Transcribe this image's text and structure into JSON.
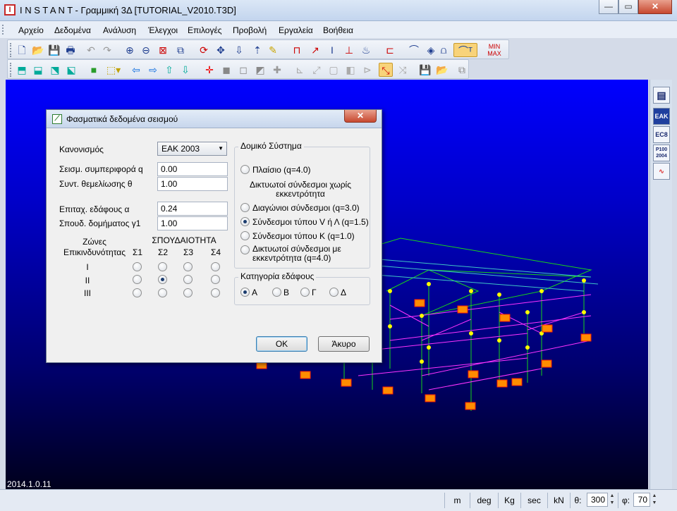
{
  "window": {
    "title": "I N S T A N T - Γραμμική 3Δ [TUTORIAL_V2010.T3D]",
    "controls": {
      "minimize": "—",
      "maximize": "▭",
      "close": "✕"
    }
  },
  "menu": [
    "Αρχείο",
    "Δεδομένα",
    "Ανάλυση",
    "Έλεγχοι",
    "Επιλογές",
    "Προβολή",
    "Εργαλεία",
    "Βοήθεια"
  ],
  "toolbar1": [
    "new-icon",
    "open-icon",
    "save-icon",
    "print-icon",
    "undo-icon",
    "redo-icon",
    "zoom-in-icon",
    "zoom-out-icon",
    "zoom-extents-icon",
    "zoom-window-icon",
    "rotate-icon",
    "pan-icon",
    "load-icon",
    "ruler-icon",
    "frame-icon",
    "member-icon",
    "support-icon",
    "section-icon",
    "beam-icon",
    "diagram-icon",
    "spectrum-icon",
    "minmax-icon"
  ],
  "toolbar2": [
    "view-iso-icon",
    "view-front-icon",
    "view-side-icon",
    "view-top-icon",
    "color-box-icon",
    "selection-icon",
    "left-arrow-icon",
    "right-arrow-icon",
    "up-arrow-icon",
    "down-arrow-icon",
    "node-icon"
  ],
  "version": "2014.1.0.11",
  "rightbar": [
    "window-icon",
    "ΕΑΚ",
    "EC8",
    "P100 2004",
    "spectrum-chart-icon"
  ],
  "statusbar": {
    "units": [
      "m",
      "deg",
      "Kg",
      "sec",
      "kN"
    ],
    "theta_label": "θ:",
    "theta_value": "300",
    "phi_label": "φ:",
    "phi_value": "70"
  },
  "dialog": {
    "title": "Φασματικά δεδομένα σεισμού",
    "code_label": "Κανονισμός",
    "code_value": "ΕΑΚ 2003",
    "q_label": "Σεισμ. συμπεριφορά q",
    "q_value": "0.00",
    "theta_label": "Συντ. θεμελίωσης θ",
    "theta_value": "1.00",
    "alpha_label": "Επιταχ. εδάφους α",
    "alpha_value": "0.24",
    "gamma_label": "Σπουδ. δομήματος γ1",
    "gamma_value": "1.00",
    "zones_header_1": "Ζώνες",
    "zones_header_2": "Επικινδυνότητας",
    "importance_header": "ΣΠΟΥΔΑΙΟΤΗΤΑ",
    "importance_cols": [
      "Σ1",
      "Σ2",
      "Σ3",
      "Σ4"
    ],
    "zones": [
      "I",
      "II",
      "III"
    ],
    "zone_grid_selected": {
      "row": 1,
      "col": 1
    },
    "system_group": "Δομικό Σύστημα",
    "frame_option": "Πλαίσιο (q=4.0)",
    "braced_heading": "Δικτυωτοί σύνδεσμοι χωρίς εκκεντρότητα",
    "diagonal_option": "Διαγώνιοι σύνδεσμοι (q=3.0)",
    "v_option": "Σύνδεσμοι τύπου V ή Λ (q=1.5)",
    "k_option": "Σύνδεσμοι τύπου Κ (q=1.0)",
    "eccentric_option": "Δικτυωτοί σύνδεσμοι με εκκεντρότητα (q=4.0)",
    "soil_group": "Κατηγορία εδάφους",
    "soil_options": [
      "Α",
      "Β",
      "Γ",
      "Δ"
    ],
    "ok_label": "OK",
    "cancel_label": "Άκυρο"
  }
}
